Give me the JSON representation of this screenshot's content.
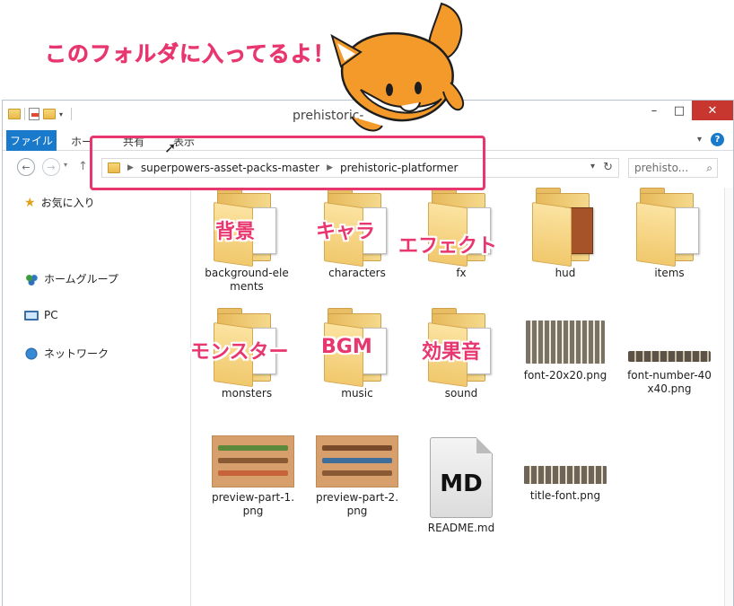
{
  "callout": "このフォルダに入ってるよ！",
  "window": {
    "title": "prehistoric-",
    "minimize": "–",
    "maximize": "□",
    "close": "✕"
  },
  "ribbon": {
    "file_tab": "ファイル",
    "tabs": [
      "ホー",
      "共有",
      "表示"
    ],
    "help": "?"
  },
  "navigation": {
    "back": "←",
    "forward": "→",
    "breadcrumb": [
      "superpowers-asset-packs-master",
      "prehistoric-platformer"
    ],
    "search_placeholder": "prehisto..."
  },
  "nav_pane": {
    "favorites": "お気に入り",
    "homegroup": "ホームグループ",
    "pc": "PC",
    "network": "ネットワーク"
  },
  "items": [
    {
      "name": "background-elements",
      "label_line1": "background-ele",
      "label_line2": "ments",
      "type": "folder"
    },
    {
      "name": "characters",
      "label_line1": "characters",
      "type": "folder"
    },
    {
      "name": "fx",
      "label_line1": "fx",
      "type": "folder"
    },
    {
      "name": "hud",
      "label_line1": "hud",
      "type": "folder"
    },
    {
      "name": "items",
      "label_line1": "items",
      "type": "folder"
    },
    {
      "name": "monsters",
      "label_line1": "monsters",
      "type": "folder"
    },
    {
      "name": "music",
      "label_line1": "music",
      "type": "folder"
    },
    {
      "name": "sound",
      "label_line1": "sound",
      "type": "folder"
    },
    {
      "name": "font-20x20.png",
      "label_line1": "font-20x20.png",
      "type": "image"
    },
    {
      "name": "font-number-40x40.png",
      "label_line1": "font-number-40",
      "label_line2": "x40.png",
      "type": "image"
    },
    {
      "name": "preview-part-1.png",
      "label_line1": "preview-part-1.",
      "label_line2": "png",
      "type": "image"
    },
    {
      "name": "preview-part-2.png",
      "label_line1": "preview-part-2.",
      "label_line2": "png",
      "type": "image"
    },
    {
      "name": "README.md",
      "label_line1": "README.md",
      "type": "markdown"
    },
    {
      "name": "title-font.png",
      "label_line1": "title-font.png",
      "type": "image"
    }
  ],
  "md_badge": "MD",
  "annotations": {
    "background": "背景",
    "characters": "キャラ",
    "effects": "エフェクト",
    "monsters": "モンスター",
    "music": "BGM",
    "sound": "効果音"
  },
  "colors": {
    "accent_pink": "#e8366f",
    "file_tab_blue": "#1979ca",
    "close_red": "#c7372f",
    "folder_yellow": "#f1c86c"
  }
}
